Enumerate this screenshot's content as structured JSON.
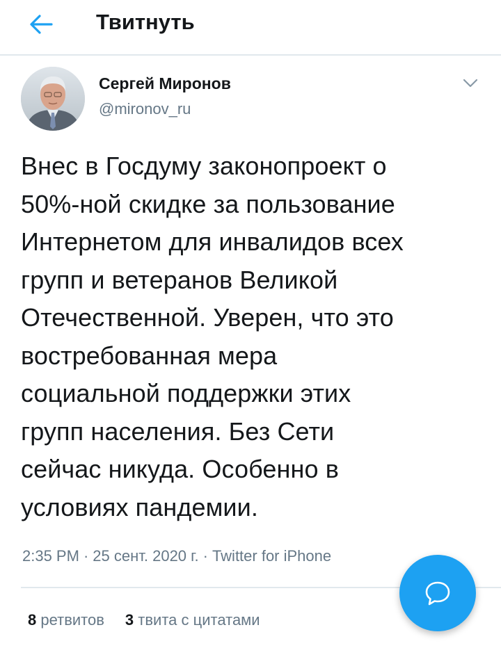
{
  "header": {
    "title": "Твитнуть",
    "back_icon": "arrow-left-icon"
  },
  "author": {
    "name": "Сергей Миронов",
    "handle": "@mironov_ru",
    "avatar_icon": "avatar-photo",
    "menu_icon": "chevron-down-icon"
  },
  "tweet": {
    "text": "Внес в Госдуму законопроект о\n50%-ной скидке за пользование\nИнтернетом для инвалидов всех\nгрупп и ветеранов Великой\nОтечественной. Уверен, что это\nвостребованная мера\nсоциальной поддержки этих\nгрупп населения. Без Сети\nсейчас никуда. Особенно в\nусловиях пандемии.",
    "time": "2:35 PM",
    "date": "25 сент. 2020 г.",
    "source": "Twitter for iPhone",
    "separator": "·"
  },
  "stats": {
    "retweets_count": "8",
    "retweets_label": "ретвитов",
    "quotes_count": "3",
    "quotes_label": "твита с цитатами"
  },
  "fab": {
    "icon": "compose-reply-icon"
  },
  "colors": {
    "accent": "#1da1f2",
    "text": "#14171a",
    "secondary_text": "#657786",
    "divider": "#e1e8ed"
  }
}
